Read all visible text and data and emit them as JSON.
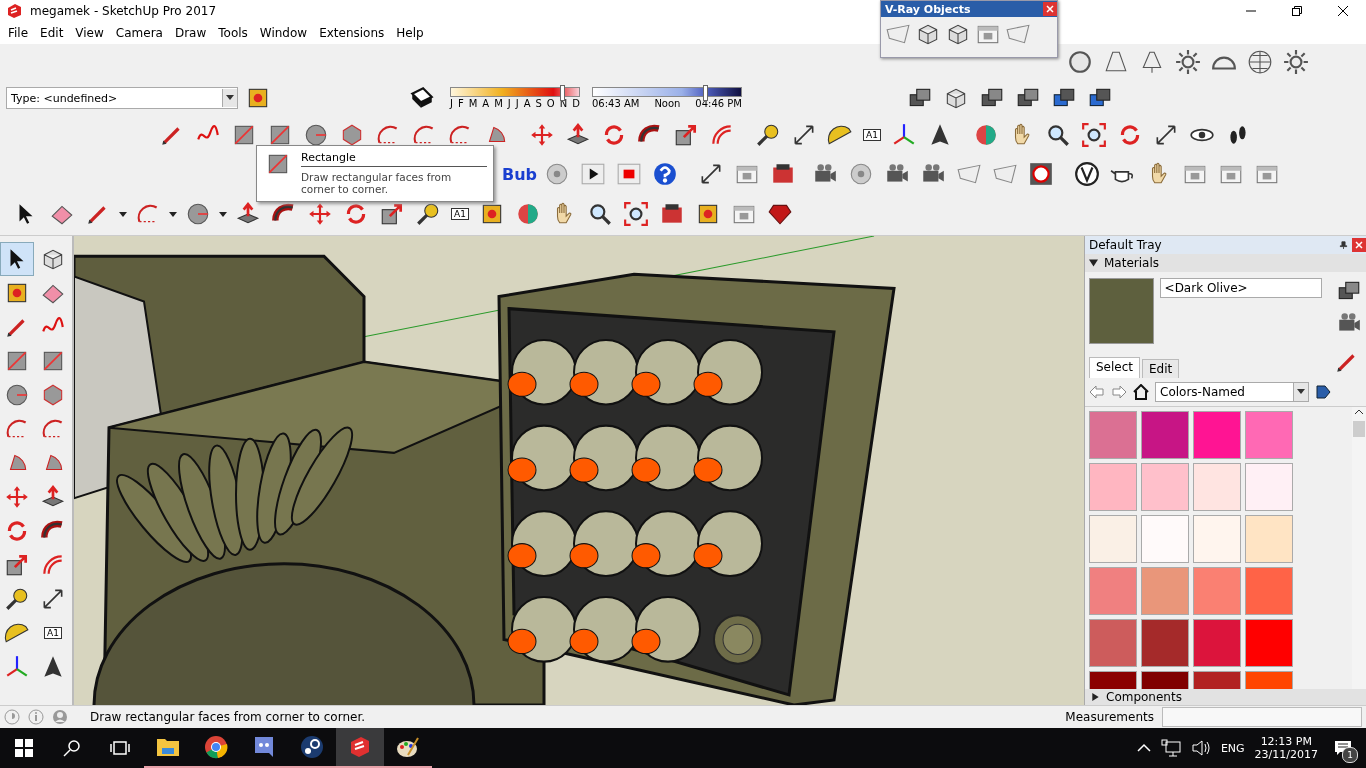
{
  "window": {
    "title": "megamek - SketchUp Pro 2017"
  },
  "menu": [
    "File",
    "Edit",
    "View",
    "Camera",
    "Draw",
    "Tools",
    "Window",
    "Extensions",
    "Help"
  ],
  "vray_objects": {
    "title": "V-Ray Objects"
  },
  "entity_info": {
    "type": "Type: <undefined>"
  },
  "shadows": {
    "months": [
      "J",
      "F",
      "M",
      "A",
      "M",
      "J",
      "J",
      "A",
      "S",
      "O",
      "N",
      "D"
    ],
    "date_slider": {
      "level": 0.87
    },
    "times": [
      "06:43 AM",
      "Noon",
      "04:46 PM"
    ],
    "time_slider": {
      "level": 0.76
    }
  },
  "plugin_label": "Bub",
  "text_tool_labels": [
    "A1",
    "A1",
    "A1"
  ],
  "tooltip": {
    "title": "Rectangle",
    "text": "Draw rectangular faces from corner to corner."
  },
  "tray": {
    "title": "Default Tray",
    "panel": "Materials",
    "material_name": "<Dark Olive>",
    "tabs": [
      {
        "label": "Select",
        "selected": true
      },
      {
        "label": "Edit",
        "selected": false
      }
    ],
    "library": "Colors-Named",
    "swatches": [
      {
        "color": "#db7093"
      },
      {
        "color": "#c71585"
      },
      {
        "color": "#ff1493"
      },
      {
        "color": "#ff69b4"
      },
      {
        "color": "#ffb6c1"
      },
      {
        "color": "#ffc0cb"
      },
      {
        "color": "#ffe4e1"
      },
      {
        "color": "#fff0f5"
      },
      {
        "color": "#faf0e6"
      },
      {
        "color": "#fffafa"
      },
      {
        "color": "#fff5ee"
      },
      {
        "color": "#ffe4c4"
      },
      {
        "color": "#f08080"
      },
      {
        "color": "#e9967a"
      },
      {
        "color": "#fa8072"
      },
      {
        "color": "#ff6347"
      },
      {
        "color": "#cd5c5c"
      },
      {
        "color": "#a52a2a"
      },
      {
        "color": "#dc143c"
      },
      {
        "color": "#ff0000"
      },
      {
        "color": "#8b0000"
      },
      {
        "color": "#800000"
      },
      {
        "color": "#b22222"
      },
      {
        "color": "#ff4500"
      }
    ],
    "next_panel": "Components"
  },
  "status_bar": {
    "text": "Draw rectangular faces from corner to corner.",
    "measurements_label": "Measurements"
  },
  "taskbar": {
    "language": "ENG",
    "time": "12:13 PM",
    "date": "23/11/2017",
    "notifications": "1"
  }
}
